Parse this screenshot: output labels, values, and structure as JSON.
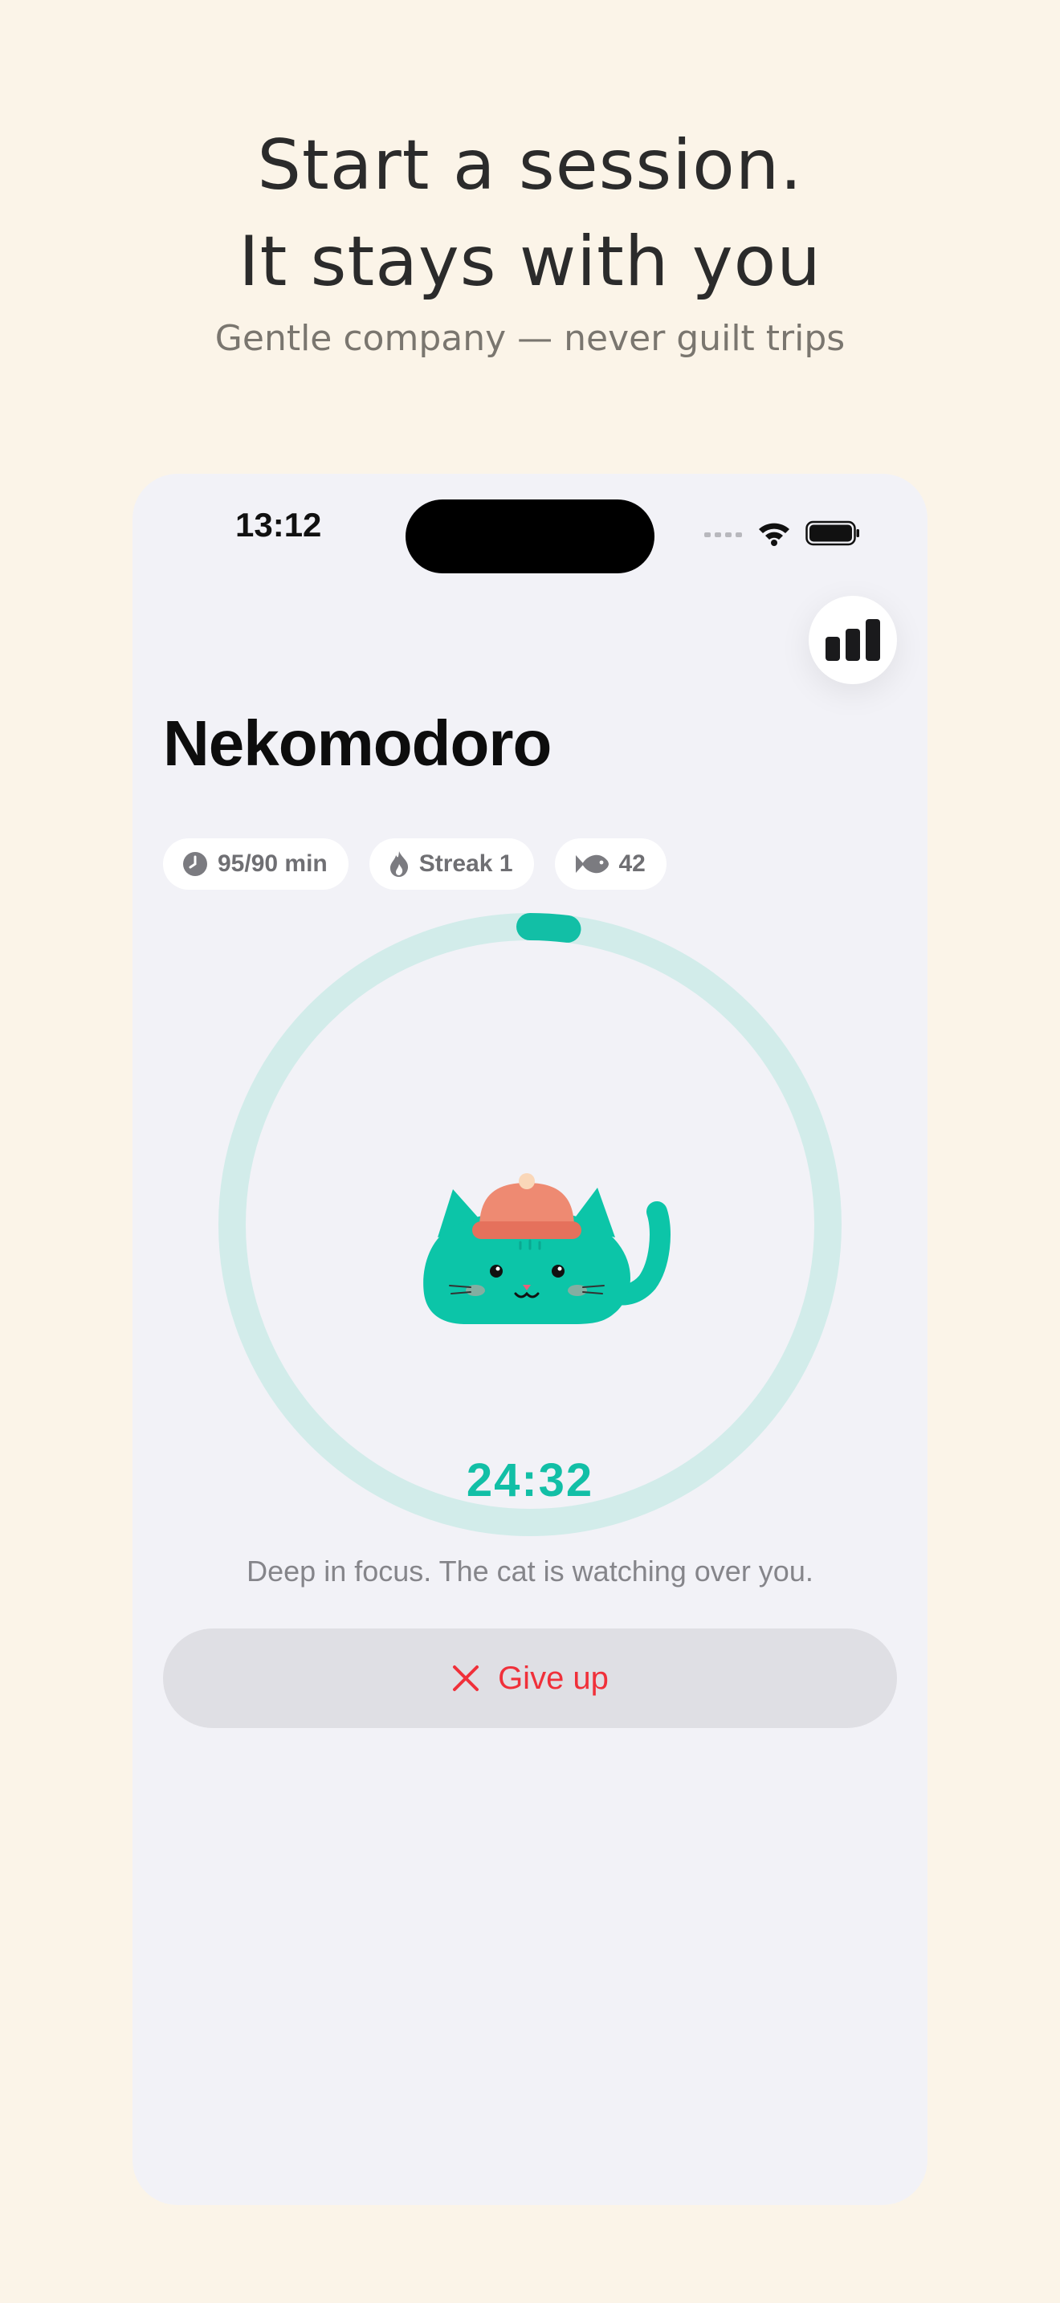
{
  "promo": {
    "headline_line1": "Start a session.",
    "headline_line2": "It stays with you",
    "subheadline": "Gentle company — never guilt trips"
  },
  "status_bar": {
    "time": "13:12",
    "icons": [
      "signal-icon",
      "wifi-icon",
      "battery-icon"
    ]
  },
  "app": {
    "title": "Nekomodoro",
    "stats_button_icon": "bar-chart-icon"
  },
  "chips": [
    {
      "icon": "clock-icon",
      "label": "95/90 min"
    },
    {
      "icon": "flame-icon",
      "label": "Streak 1"
    },
    {
      "icon": "fish-icon",
      "label": "42"
    }
  ],
  "session": {
    "timer": "24:32",
    "progress_fraction": 0.02,
    "message": "Deep in focus. The cat is watching over you.",
    "give_up_label": "Give up"
  },
  "colors": {
    "background": "#FBF4E8",
    "phone_bg": "#F2F2F7",
    "accent": "#12BFA6",
    "ring_track": "#D2ECEA",
    "danger": "#F0303A",
    "cat_body": "#0CC5A8",
    "hat": "#EE8A72"
  }
}
